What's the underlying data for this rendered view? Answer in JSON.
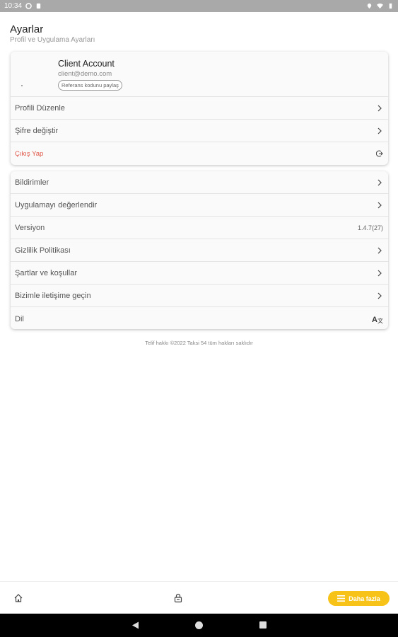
{
  "status_bar": {
    "time": "10:34",
    "battery_icon": "battery-icon",
    "wifi_icon": "wifi-icon",
    "location_icon": "location-icon"
  },
  "header": {
    "title": "Ayarlar",
    "subtitle": "Profil ve Uygulama Ayarları"
  },
  "account": {
    "name": "Client Account",
    "email": "client@demo.com",
    "referral_label": "Referans kodunu paylaş"
  },
  "account_menu": [
    {
      "label": "Profili Düzenle",
      "icon": "chevron-right-icon"
    },
    {
      "label": "Şifre değiştir",
      "icon": "chevron-right-icon"
    }
  ],
  "logout": {
    "label": "Çıkış Yap",
    "icon": "logout-icon"
  },
  "settings_menu": [
    {
      "label": "Bildirimler",
      "icon": "chevron-right-icon"
    },
    {
      "label": "Uygulamayı değerlendir",
      "icon": "chevron-right-icon"
    },
    {
      "label": "Versiyon",
      "value": "1.4.7(27)"
    },
    {
      "label": "Gizlilik Politikası",
      "icon": "chevron-right-icon"
    },
    {
      "label": "Şartlar ve koşullar",
      "icon": "chevron-right-icon"
    },
    {
      "label": "Bizimle iletişime geçin",
      "icon": "chevron-right-icon"
    },
    {
      "label": "Dil",
      "icon": "translate-icon"
    }
  ],
  "copyright": "Telif hakkı ©2022 Taksi 54 tüm hakları saklıdır",
  "bottom_nav": {
    "home_icon": "home-icon",
    "lock_icon": "lock-icon",
    "more_label": "Daha fazla"
  },
  "colors": {
    "accent": "#f7c318",
    "logout": "#e0574a"
  }
}
